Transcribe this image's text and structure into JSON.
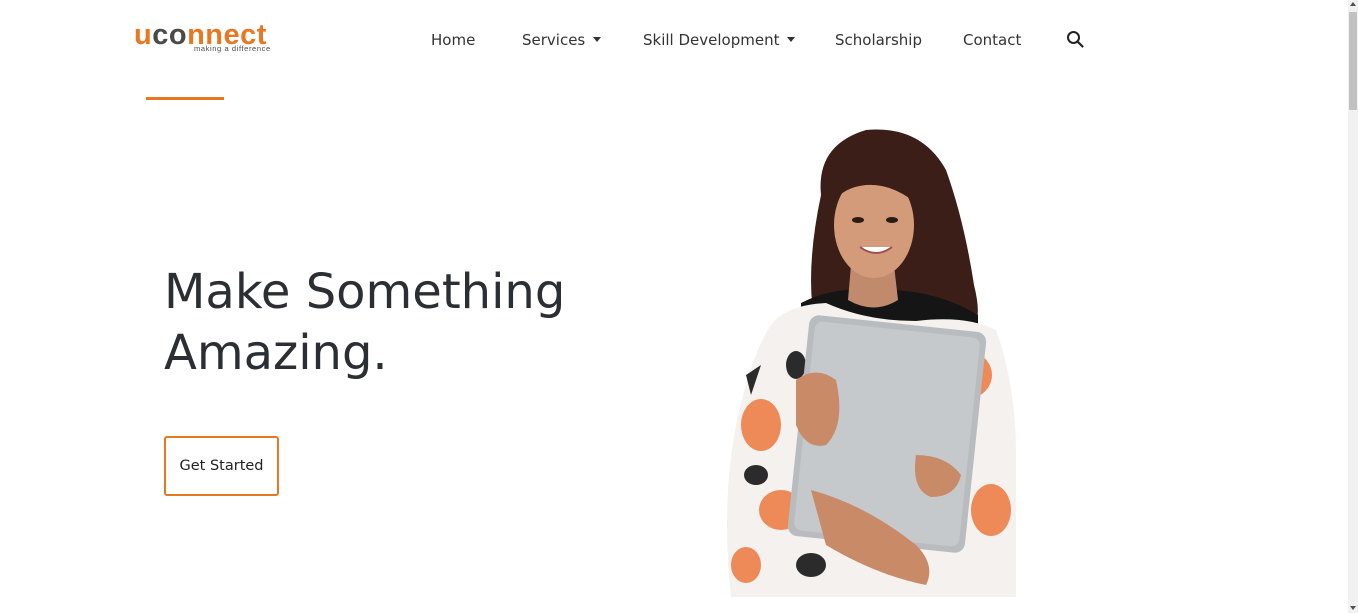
{
  "brand": {
    "logo_prefix": "u",
    "logo_mid": "co",
    "logo_suffix": "nnect",
    "tagline": "making a difference",
    "accent_color": "#e87722"
  },
  "nav": {
    "items": [
      {
        "label": "Home"
      },
      {
        "label": "Services",
        "has_dropdown": true
      },
      {
        "label": "Skill Development",
        "has_dropdown": true
      },
      {
        "label": "Scholarship"
      },
      {
        "label": "Contact"
      }
    ],
    "search_icon": "search-icon"
  },
  "hero": {
    "title_line1": "Make Something",
    "title_line2": "Amazing.",
    "cta_label": "Get Started",
    "image": "student-holding-laptop"
  }
}
